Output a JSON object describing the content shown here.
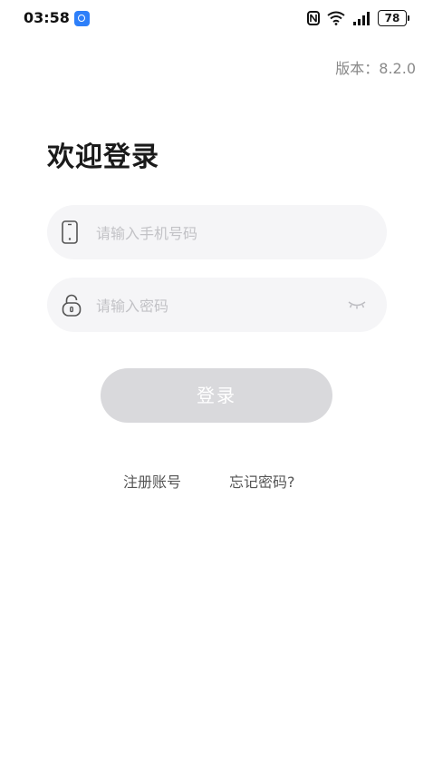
{
  "status_bar": {
    "time": "03:58",
    "battery": "78",
    "icons": [
      "app-notification-icon",
      "nfc-icon",
      "wifi-icon",
      "signal-icon",
      "battery-icon"
    ]
  },
  "version": "版本：8.2.0",
  "title": "欢迎登录",
  "phone_field": {
    "placeholder": "请输入手机号码",
    "value": "",
    "icon": "phone-icon"
  },
  "password_field": {
    "placeholder": "请输入密码",
    "value": "",
    "icon": "lock-icon",
    "toggle_icon": "eye-closed-icon"
  },
  "login_button": {
    "label": "登录",
    "enabled": false
  },
  "links": {
    "register": "注册账号",
    "forgot_password": "忘记密码?"
  },
  "colors": {
    "button_disabled": "#d9d9dc",
    "field_bg": "#f5f5f7",
    "placeholder": "#c2c2c6",
    "version_text": "#8a8a8a"
  }
}
